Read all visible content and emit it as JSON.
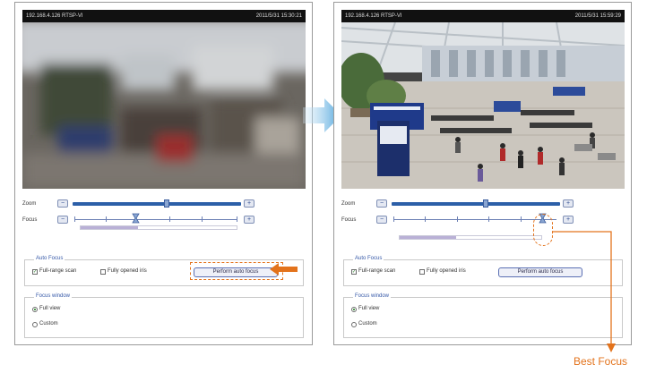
{
  "left_panel": {
    "ip": "192.168.4.126 RTSP-VI",
    "timestamp": "2011/5/31 15:30:21",
    "zoom_label": "Zoom",
    "focus_label": "Focus",
    "auto_focus_title": "Auto Focus",
    "full_range_label": "Full-range scan",
    "fully_opened_label": "Fully opened iris",
    "perform_label": "Perform auto focus",
    "focus_window_title": "Focus window",
    "full_view_label": "Full view",
    "custom_label": "Custom"
  },
  "right_panel": {
    "ip": "192.168.4.126 RTSP-VI",
    "timestamp": "2011/5/31 15:59:29",
    "zoom_label": "Zoom",
    "focus_label": "Focus",
    "auto_focus_title": "Auto Focus",
    "full_range_label": "Full-range scan",
    "fully_opened_label": "Fully opened iris",
    "perform_label": "Perform auto focus",
    "focus_window_title": "Focus window",
    "full_view_label": "Full view",
    "custom_label": "Custom"
  },
  "annotation": {
    "best_focus": "Best Focus"
  },
  "colors": {
    "accent_orange": "#e3731c",
    "arrow_blue": "#6fb3e3",
    "track_blue": "#2c5fa8"
  },
  "state": {
    "left": {
      "zoom_level": 0.62,
      "focus_level": 0.38,
      "progress": 0.37
    },
    "right": {
      "zoom_level": 0.62,
      "focus_level": 0.89,
      "progress": 0.4
    }
  }
}
